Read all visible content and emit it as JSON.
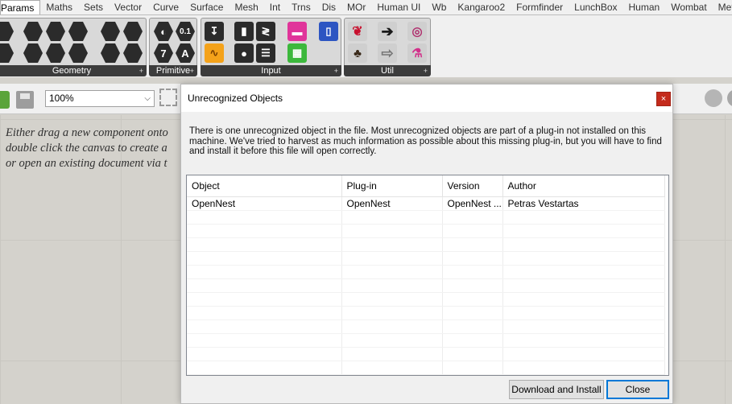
{
  "tabs": [
    "Params",
    "Maths",
    "Sets",
    "Vector",
    "Curve",
    "Surface",
    "Mesh",
    "Int",
    "Trns",
    "Dis",
    "MOr",
    "Human UI",
    "Wb",
    "Kangaroo2",
    "Formfinder",
    "LunchBox",
    "Human",
    "Wombat",
    "Meta"
  ],
  "active_tab": "Params",
  "ribbon": {
    "groups": [
      "Geometry",
      "Primitive",
      "Input",
      "Util"
    ],
    "primitive_icons": [
      "0.1",
      "7",
      "A"
    ],
    "more_glyph": "+"
  },
  "toolbar": {
    "zoom_value": "100%"
  },
  "canvas": {
    "hint_lines": [
      "Either drag a new component onto",
      "double click the canvas to create a",
      "or open an existing document via t"
    ]
  },
  "dialog": {
    "title": "Unrecognized Objects",
    "close_glyph": "×",
    "message": "There is one unrecognized object in the file. Most unrecognized objects are part of a plug-in not installed on this machine. We've tried to harvest as much information as possible about this missing plug-in, but you will have to find and install it before this file will open correctly.",
    "columns": [
      "Object",
      "Plug-in",
      "Version",
      "Author"
    ],
    "rows": [
      [
        "OpenNest",
        "OpenNest",
        "OpenNest ...",
        "Petras Vestartas"
      ]
    ],
    "buttons": {
      "download": "Download and Install",
      "close": "Close"
    }
  },
  "colors": {
    "canvas": "#d4d2cc",
    "ribbon_label": "#3c3c3c",
    "close_red": "#c42b1c",
    "default_button_border": "#0078d7"
  }
}
